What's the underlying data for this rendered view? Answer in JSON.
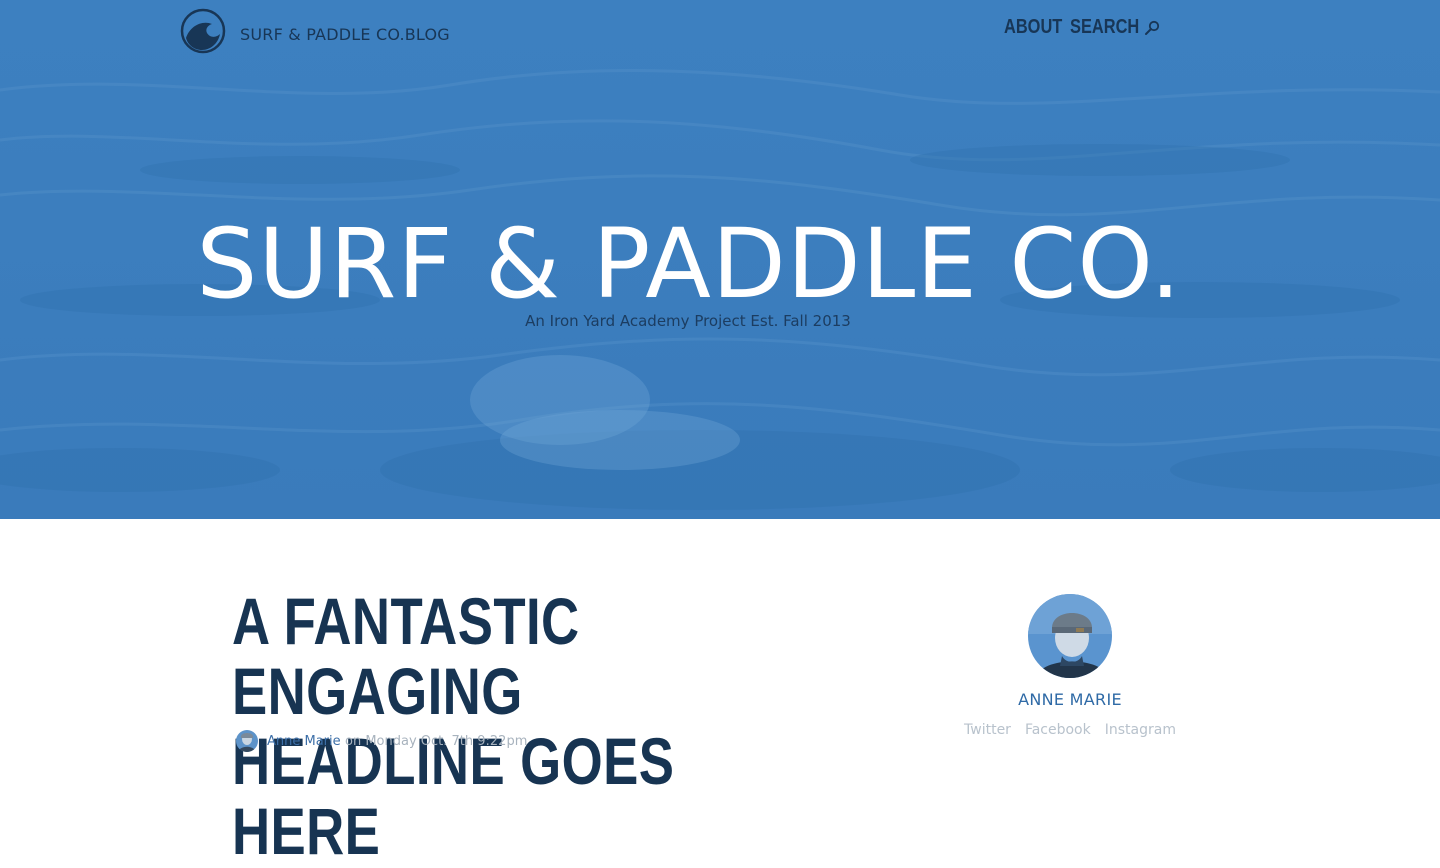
{
  "colors": {
    "hero_bg": "#3d80c0",
    "navy": "#173452",
    "link_blue": "#2f6aa6",
    "muted": "#b8c2cc"
  },
  "header": {
    "logo_icon": "wave-icon",
    "blog_name": "SURF & PADDLE CO.BLOG",
    "nav": {
      "about": "ABOUT",
      "search": "SEARCH",
      "search_icon": "search-icon"
    }
  },
  "hero": {
    "title": "SURF & PADDLE CO.",
    "subtitle": "An Iron Yard Academy Project Est. Fall 2013"
  },
  "post": {
    "headline_line1": "A FANTASTIC ENGAGING",
    "headline_line2": "HEADLINE GOES HERE",
    "author": "Anne Marie",
    "date": "on Monday Oct. 7th 9:22pm"
  },
  "author_card": {
    "name": "ANNE MARIE",
    "links": [
      "Twitter",
      "Facebook",
      "Instagram"
    ]
  }
}
